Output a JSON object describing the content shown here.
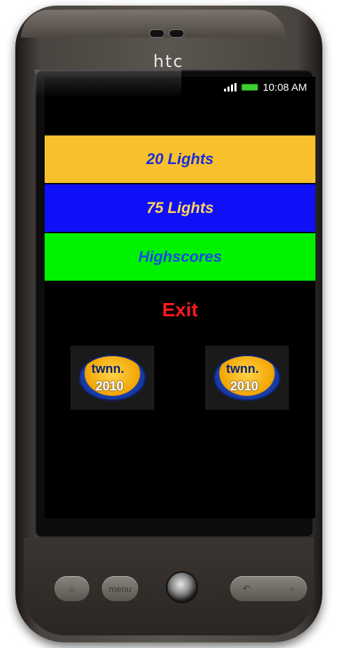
{
  "device": {
    "brand": "htc"
  },
  "status_bar": {
    "time": "10:08 AM",
    "signal_icon": "signal-icon",
    "battery_icon": "battery-icon"
  },
  "menu": {
    "btn_20_label": "20 Lights",
    "btn_75_label": "75 Lights",
    "highscores_label": "Highscores",
    "exit_label": "Exit"
  },
  "logos": {
    "top_text": "twnn.",
    "year_text": "2010"
  },
  "hardware": {
    "menu_label": "menu"
  },
  "colors": {
    "btn_20_bg": "#f8c02d",
    "btn_75_bg": "#1010f8",
    "highscores_bg": "#00f200",
    "exit_text": "#ff1a1a"
  }
}
